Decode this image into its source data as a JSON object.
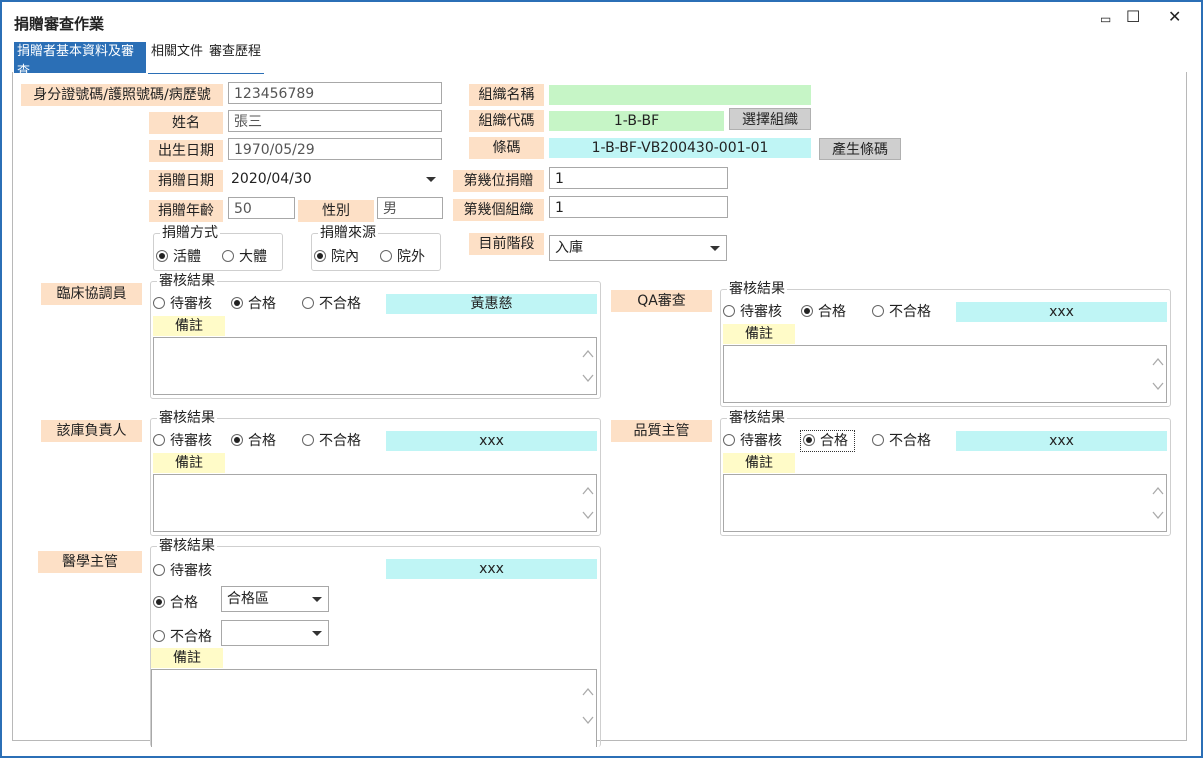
{
  "window": {
    "title": "捐贈審查作業",
    "minimize_glyph": "▭",
    "maximize_glyph": "☐",
    "close_glyph": "✕"
  },
  "tabs": [
    {
      "label": "捐贈者基本資料及審查",
      "active": true
    },
    {
      "label": "相關文件",
      "active": false
    },
    {
      "label": "審查歷程",
      "active": false
    }
  ],
  "donor": {
    "id_label": "身分證號碼/護照號碼/病歷號",
    "id_value": "123456789",
    "name_label": "姓名",
    "name_value": "張三",
    "birth_label": "出生日期",
    "birth_value": "1970/05/29",
    "donate_date_label": "捐贈日期",
    "donate_date_value": "2020/04/30",
    "age_label": "捐贈年齡",
    "age_value": "50",
    "gender_label": "性別",
    "gender_value": "男",
    "method_legend": "捐贈方式",
    "method_live": "活體",
    "method_cadaver": "大體",
    "source_legend": "捐贈來源",
    "source_in": "院內",
    "source_out": "院外"
  },
  "org": {
    "name_label": "組織名稱",
    "name_value": "",
    "code_label": "組織代碼",
    "code_value": "1-B-BF",
    "choose_btn": "選擇組織",
    "barcode_label": "條碼",
    "barcode_value": "1-B-BF-VB200430-001-01",
    "gen_btn": "產生條碼",
    "nth_donor_label": "第幾位捐贈",
    "nth_donor_value": "1",
    "nth_org_label": "第幾個組織",
    "nth_org_value": "1",
    "stage_label": "目前階段",
    "stage_value": "入庫"
  },
  "review": {
    "legend": "審核結果",
    "pending": "待審核",
    "pass": "合格",
    "fail": "不合格",
    "note": "備註",
    "clinical": {
      "label": "臨床協調員",
      "reviewer": "黃惠慈"
    },
    "qa": {
      "label": "QA審查",
      "reviewer": "xxx"
    },
    "bank": {
      "label": "該庫負責人",
      "reviewer": "xxx"
    },
    "quality": {
      "label": "品質主管",
      "reviewer": "xxx"
    },
    "medical": {
      "label": "醫學主管",
      "reviewer": "xxx",
      "pass_zone": "合格區",
      "fail_zone": ""
    }
  },
  "colors": {
    "accent": "#2b6fb6",
    "label_bg": "#fde0c6",
    "green": "#c6f5c6",
    "cyan": "#bff5f5",
    "note_bg": "#fffbc8"
  }
}
